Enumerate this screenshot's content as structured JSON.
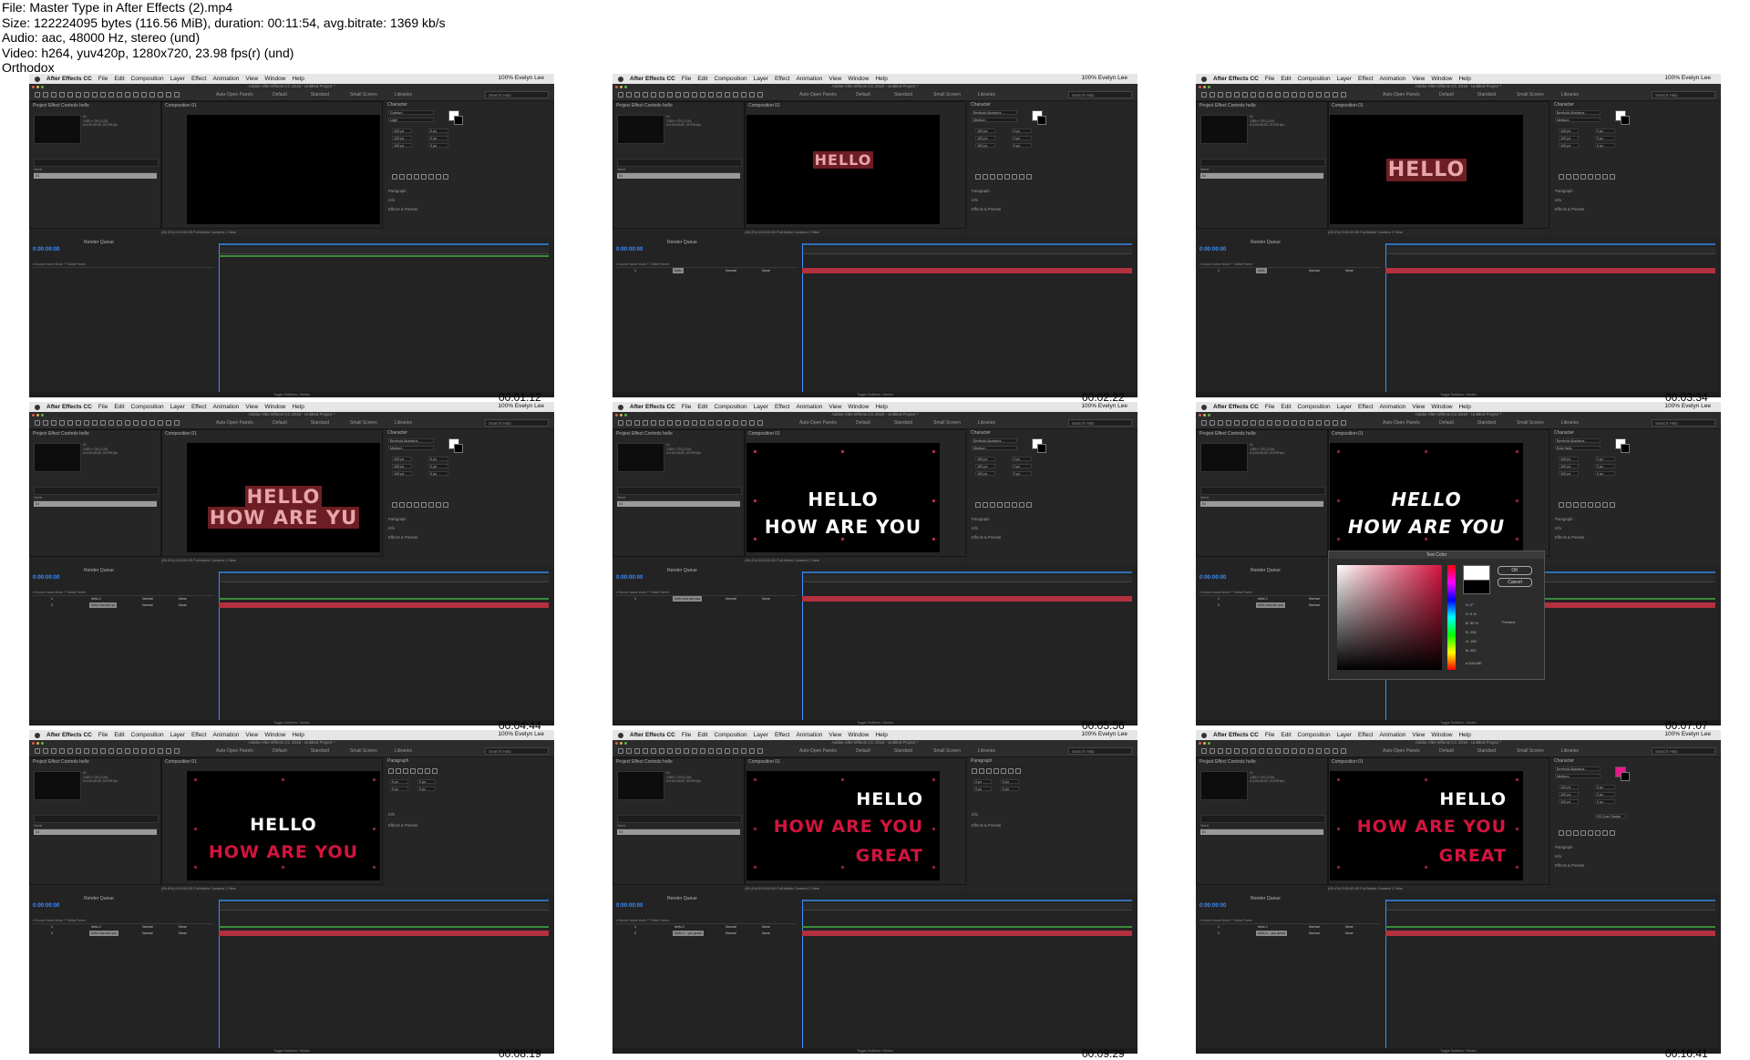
{
  "file_info": {
    "file": "File: Master Type in After Effects (2).mp4",
    "size": "Size: 122224095 bytes (116.56 MiB), duration: 00:11:54, avg.bitrate: 1369 kb/s",
    "audio": "Audio: aac, 48000 Hz, stereo (und)",
    "video": "Video: h264, yuv420p, 1280x720, 23.98 fps(r) (und)",
    "watermark": "Orthodox"
  },
  "ui": {
    "menu": [
      "After Effects CC",
      "File",
      "Edit",
      "Composition",
      "Layer",
      "Effect",
      "Animation",
      "View",
      "Window",
      "Help"
    ],
    "menu_right": "100%  Evelyn Lee",
    "window_title": "Adobe After Effects CC 2018 - Untitled Project *",
    "workspaces": [
      "Auto-Open Panels",
      "Default",
      "Standard",
      "Small Screen",
      "Libraries"
    ],
    "search_help": "Search Help",
    "project_tab": "Project",
    "effect_controls": "Effect Controls hello",
    "comp_tab": "Composition 01",
    "comp_name": "01",
    "comp_info": "1280 x 720 (1.00)\nΔ 0;00;30;00, 23.976 fps",
    "name_col": "Name",
    "character_tab": "Character",
    "paragraph_tab": "Paragraph",
    "sections": [
      "Paragraph",
      "Info",
      "Effects & Presets"
    ],
    "viewer_zoom": "(45.4%)",
    "viewer_quality": "Full",
    "viewer_camera": "Active Camera",
    "viewer_views": "1 View",
    "timecode": "0:00:00:00",
    "render_queue": "Render Queue",
    "layer_cols": [
      "#",
      "Source Name",
      "Mode",
      "T TrkMat",
      "Parent"
    ],
    "mode_value": "Normal",
    "parent_value": "None",
    "status_bar": "Toggle Switches / Modes",
    "color_dialog_title": "Text Color",
    "ok": "OK",
    "cancel": "Cancel",
    "hex": "# D3143E",
    "color_values": [
      "H: 0°",
      "S: 0 %",
      "B: 99 %",
      "R: 252",
      "G: 252",
      "B: 252"
    ],
    "preview": "Preview"
  },
  "thumbs": [
    {
      "time": "00:01:12",
      "font": "Gotham",
      "weight": "Light",
      "lines": [],
      "layers": []
    },
    {
      "time": "00:02:22",
      "font": "Berthold Akzidenz...",
      "weight": "Medium",
      "lines": [
        "HELLO"
      ],
      "layers": [
        "hello"
      ]
    },
    {
      "time": "00:03:34",
      "font": "Berthold Akzidenz...",
      "weight": "Medium",
      "lines": [
        "HELLO"
      ],
      "layers": [
        "hello"
      ]
    },
    {
      "time": "00:04:44",
      "font": "Berthold Akzidenz...",
      "weight": "Medium",
      "lines": [
        "HELLO",
        "HOW ARE YU"
      ],
      "layers": [
        "hello 2",
        "hello how are yu"
      ]
    },
    {
      "time": "00:05:56",
      "font": "Berthold Akzidenz...",
      "weight": "Medium",
      "lines": [
        "HELLO",
        "HOW ARE YOU"
      ],
      "layers": [
        "hello how are you"
      ]
    },
    {
      "time": "00:07:07",
      "font": "Berthold Akzidenz...",
      "weight": "Bold Italic",
      "lines": [
        "HELLO",
        "HOW ARE YOU"
      ],
      "layers": [
        "hello 2",
        "hello how are you"
      ]
    },
    {
      "time": "00:08:19",
      "font": "",
      "weight": "",
      "lines": [
        "HELLO",
        "HOW ARE YOU"
      ],
      "layers": [
        "hello 2",
        "hello how are you"
      ]
    },
    {
      "time": "00:09:29",
      "font": "",
      "weight": "",
      "lines": [
        "HELLO",
        "HOW ARE YOU",
        "GREAT"
      ],
      "layers": [
        "hello 2",
        "hello h... you great"
      ]
    },
    {
      "time": "00:10:41",
      "font": "Berthold Akzidenz...",
      "weight": "Medium",
      "lines": [
        "HELLO",
        "HOW ARE YOU",
        "GREAT"
      ],
      "layers": [
        "hello 2",
        "hello h... you great"
      ],
      "stroke": "Fill Over Stroke"
    }
  ],
  "colors": {
    "white_text": "#ffffff",
    "pink_text": "#e7a6a8",
    "red_text": "#d3143e",
    "highlight": "#6d1e24",
    "track": "#b3303f"
  }
}
